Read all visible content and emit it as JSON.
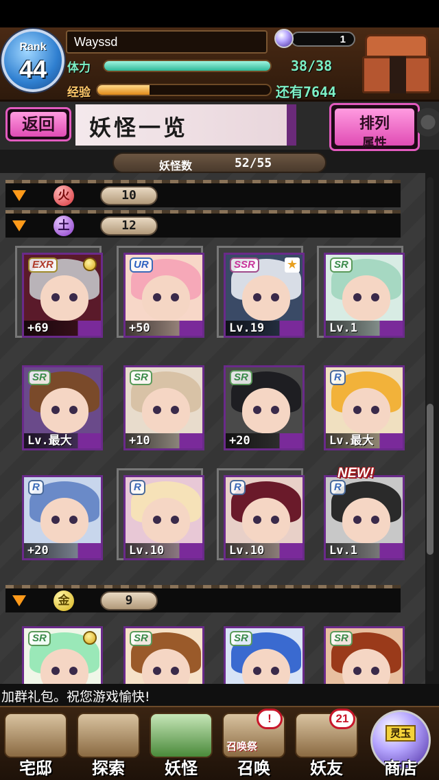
{
  "player": {
    "rank_label": "Rank",
    "rank": "44",
    "name": "Wayssd",
    "orb_count": "1",
    "stamina_label": "体力",
    "stamina_text": "38/38",
    "stamina_fraction": 1.0,
    "exp_label": "经验",
    "exp_fraction": 0.3,
    "exp_remaining": "还有7644"
  },
  "page": {
    "back_label": "返回",
    "title": "妖怪一览",
    "sort_line1": "排列",
    "sort_line2": "属性",
    "count_label": "妖怪数",
    "count_value": "52/55"
  },
  "groups": [
    {
      "attr": "火",
      "count": "10"
    },
    {
      "attr": "土",
      "count": "12"
    },
    {
      "attr": "金",
      "count": "9"
    }
  ],
  "cards": [
    {
      "rarity": "EXR",
      "level": "+69",
      "hair": "#b9b3b8",
      "bg": "#5a1a2a"
    },
    {
      "rarity": "UR",
      "level": "+50",
      "hair": "#f6a8b8",
      "bg": "#f7d7c8"
    },
    {
      "rarity": "SSR",
      "level": "Lv.19",
      "hair": "#d8dde6",
      "bg": "#3a4a66"
    },
    {
      "rarity": "SR",
      "level": "Lv.1",
      "hair": "#a6d8c2",
      "bg": "#d8ece4"
    },
    {
      "rarity": "SR",
      "level": "Lv.最大",
      "hair": "#7a4a2a",
      "bg": "#6a4a8a"
    },
    {
      "rarity": "SR",
      "level": "+10",
      "hair": "#d8c2a6",
      "bg": "#e8dccc"
    },
    {
      "rarity": "SR",
      "level": "+20",
      "hair": "#1e1e22",
      "bg": "#4a4a4a"
    },
    {
      "rarity": "R",
      "level": "Lv.最大",
      "hair": "#f2b23a",
      "bg": "#f0e0c0"
    },
    {
      "rarity": "R",
      "level": "+20",
      "hair": "#6a8ac8",
      "bg": "#c8d6ec"
    },
    {
      "rarity": "R",
      "level": "Lv.10",
      "hair": "#f6e2b8",
      "bg": "#e8c8d6"
    },
    {
      "rarity": "R",
      "level": "Lv.10",
      "hair": "#6a1a2a",
      "bg": "#e8d0c8"
    },
    {
      "rarity": "R",
      "level": "Lv.1",
      "hair": "#2a2a2a",
      "bg": "#c8c8c8"
    },
    {
      "rarity": "SR",
      "level": "",
      "hair": "#9ae8b8",
      "bg": "#f0f6e8"
    },
    {
      "rarity": "SR",
      "level": "",
      "hair": "#9a5a2a",
      "bg": "#f6e2c8"
    },
    {
      "rarity": "SR",
      "level": "",
      "hair": "#3a6ad0",
      "bg": "#d8e4f6"
    },
    {
      "rarity": "SR",
      "level": "",
      "hair": "#9a3a1a",
      "bg": "#e8c0a0"
    }
  ],
  "new_badge": "NEW!",
  "ticker": "加群礼包。祝您游戏愉快!",
  "nav": [
    {
      "label": "宅邸",
      "badge": "",
      "sub": ""
    },
    {
      "label": "探索",
      "badge": "",
      "sub": ""
    },
    {
      "label": "妖怪",
      "badge": "",
      "sub": ""
    },
    {
      "label": "召唤",
      "badge": "!",
      "sub": "召唤祭"
    },
    {
      "label": "妖友",
      "badge": "21",
      "sub": ""
    },
    {
      "label": "商店",
      "badge": "",
      "sub": "灵玉"
    }
  ],
  "colors": {
    "accent_pink": "#e25bbf",
    "stamina": "#7df0c6",
    "exp": "#e08a1a",
    "card_frame": "#6a2a8a"
  }
}
